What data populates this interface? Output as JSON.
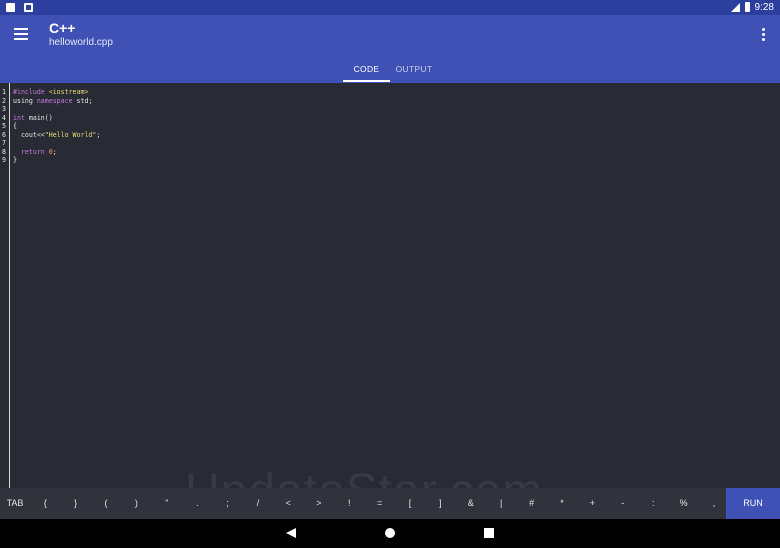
{
  "status_bar": {
    "time": "9:28",
    "icons": [
      "image-notification-icon",
      "message-notification-icon",
      "signal-icon",
      "battery-icon"
    ]
  },
  "app_bar": {
    "title": "C++",
    "subtitle": "helloworld.cpp",
    "menu_icon": "menu-icon",
    "overflow_icon": "more-vert-icon",
    "color": "#3f51b5"
  },
  "tabs": [
    {
      "label": "CODE",
      "selected": true
    },
    {
      "label": "OUTPUT",
      "selected": false
    }
  ],
  "editor": {
    "line_numbers": [
      "1",
      "2",
      "3",
      "4",
      "5",
      "6",
      "7",
      "8",
      "9"
    ],
    "lines": [
      [
        {
          "t": "#include ",
          "c": "kw"
        },
        {
          "t": "<iostream>",
          "c": "str"
        }
      ],
      [
        {
          "t": "using ",
          "c": "plain"
        },
        {
          "t": "namespace",
          "c": "kw"
        },
        {
          "t": " std;",
          "c": "plain"
        }
      ],
      [],
      [
        {
          "t": "int",
          "c": "kw"
        },
        {
          "t": " main()",
          "c": "plain"
        }
      ],
      [
        {
          "t": "{",
          "c": "plain"
        }
      ],
      [
        {
          "t": "  cout<<",
          "c": "plain"
        },
        {
          "t": "\"Hello World\"",
          "c": "str"
        },
        {
          "t": ";",
          "c": "plain"
        }
      ],
      [],
      [
        {
          "t": "  return ",
          "c": "kw"
        },
        {
          "t": "0",
          "c": "num"
        },
        {
          "t": ";",
          "c": "plain"
        }
      ],
      [
        {
          "t": "}",
          "c": "plain"
        }
      ]
    ],
    "background": "#282b33"
  },
  "keyboard_toolbar": {
    "keys": [
      "TAB",
      "{",
      "}",
      "(",
      ")",
      "\"",
      ".",
      ";",
      "/",
      "<",
      ">",
      "!",
      "=",
      "[",
      "]",
      "&",
      "|",
      "#",
      "*",
      "+",
      "-",
      ":",
      "%",
      ","
    ],
    "run_label": "RUN"
  },
  "watermark": "UpdateStar.com",
  "nav_bar": {
    "icons": [
      "back-icon",
      "home-icon",
      "recents-icon"
    ]
  }
}
